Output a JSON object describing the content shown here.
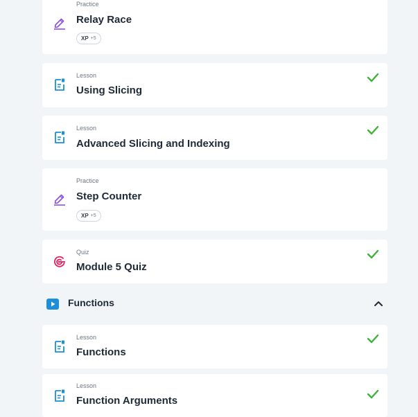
{
  "items": [
    {
      "kind": "Practice",
      "title": "Relay Race",
      "xp_label": "XP",
      "xp_points": "+5",
      "done": false,
      "icon": "pencil-icon"
    },
    {
      "kind": "Lesson",
      "title": "Using Slicing",
      "done": true,
      "icon": "document-icon"
    },
    {
      "kind": "Lesson",
      "title": "Advanced Slicing and Indexing",
      "done": true,
      "icon": "document-icon"
    },
    {
      "kind": "Practice",
      "title": "Step Counter",
      "xp_label": "XP",
      "xp_points": "+5",
      "done": false,
      "icon": "pencil-icon"
    },
    {
      "kind": "Quiz",
      "title": "Module 5 Quiz",
      "done": true,
      "icon": "target-icon"
    }
  ],
  "section": {
    "title": "Functions",
    "icon": "play-icon",
    "expanded": true
  },
  "section_items": [
    {
      "kind": "Lesson",
      "title": "Functions",
      "done": true,
      "icon": "document-icon"
    },
    {
      "kind": "Lesson",
      "title": "Function Arguments",
      "done": true,
      "icon": "document-icon"
    }
  ],
  "colors": {
    "background": "#f2f5f8",
    "practice_icon": "#8a4fe0",
    "lesson_icon": "#1b8fd9",
    "quiz_icon": "#e0245e",
    "check": "#3fb23a",
    "section_icon": "#1b8fd9"
  }
}
